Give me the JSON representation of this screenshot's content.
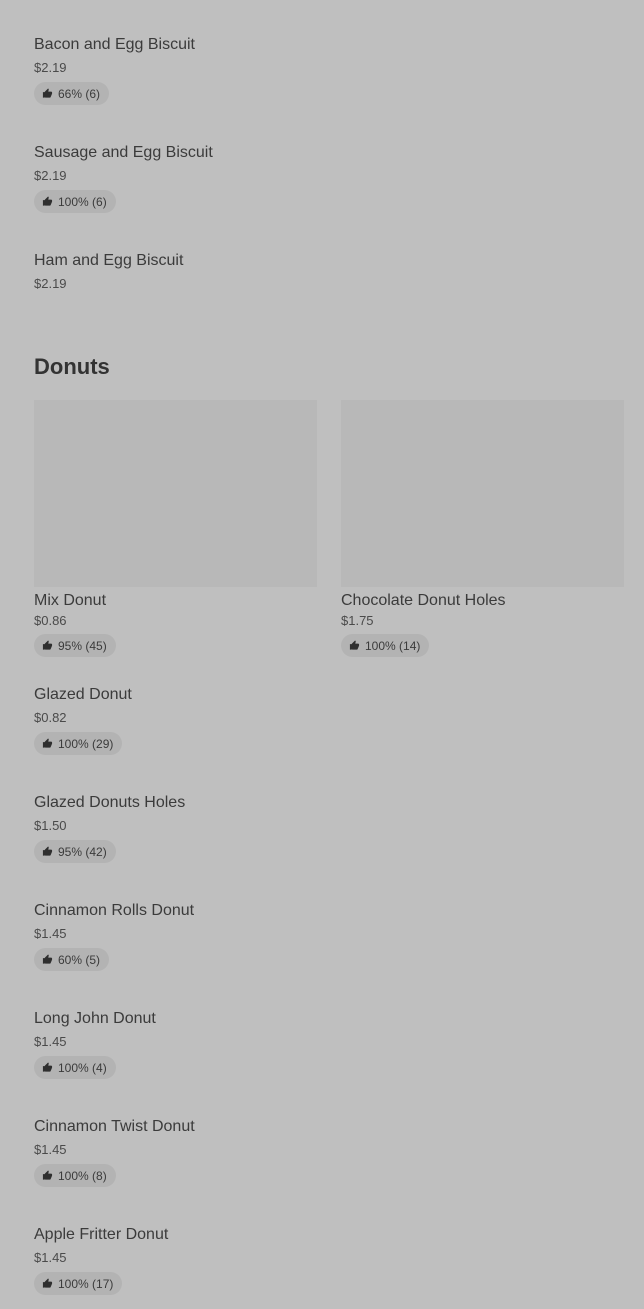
{
  "breakfast_items": [
    {
      "name": "Bacon and Egg Biscuit",
      "price": "$2.19",
      "rating": "66% (6)"
    },
    {
      "name": "Sausage and Egg Biscuit",
      "price": "$2.19",
      "rating": "100% (6)"
    },
    {
      "name": "Ham and Egg Biscuit",
      "price": "$2.19",
      "rating": ""
    }
  ],
  "donuts": {
    "title": "Donuts",
    "featured": [
      {
        "name": "Mix Donut",
        "price": "$0.86",
        "rating": "95% (45)"
      },
      {
        "name": "Chocolate Donut Holes",
        "price": "$1.75",
        "rating": "100% (14)"
      }
    ],
    "items": [
      {
        "name": "Glazed Donut",
        "price": "$0.82",
        "rating": "100% (29)"
      },
      {
        "name": "Glazed Donuts Holes",
        "price": "$1.50",
        "rating": "95% (42)"
      },
      {
        "name": "Cinnamon Rolls Donut",
        "price": "$1.45",
        "rating": "60% (5)"
      },
      {
        "name": "Long John Donut",
        "price": "$1.45",
        "rating": "100% (4)"
      },
      {
        "name": "Cinnamon Twist Donut",
        "price": "$1.45",
        "rating": "100% (8)"
      },
      {
        "name": "Apple Fritter Donut",
        "price": "$1.45",
        "rating": "100% (17)"
      }
    ]
  },
  "icons": {
    "rating": "thumbs-up-icon"
  },
  "colors": {
    "background": "#bfbfbf",
    "rating_pill": "#b3b3b3",
    "image_placeholder": "#b8b8b8",
    "text": "#3b3b3b"
  }
}
